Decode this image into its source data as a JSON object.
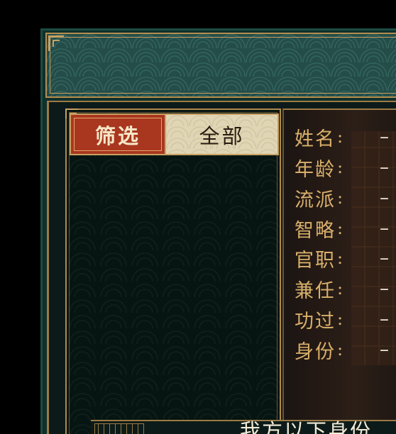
{
  "filter": {
    "label": "筛选",
    "value": "全部"
  },
  "info": {
    "rows": [
      {
        "label": "姓名",
        "colon": ":",
        "value": "–"
      },
      {
        "label": "年龄",
        "colon": ":",
        "value": "–"
      },
      {
        "label": "流派",
        "colon": ":",
        "value": "–"
      },
      {
        "label": "智略",
        "colon": ":",
        "value": "–"
      },
      {
        "label": "官职",
        "colon": ":",
        "value": "–"
      },
      {
        "label": "兼任",
        "colon": ":",
        "value": "–"
      },
      {
        "label": "功过",
        "colon": ":",
        "value": "–"
      },
      {
        "label": "身份",
        "colon": ":",
        "value": "–"
      }
    ]
  },
  "bottom": {
    "text": "我方以下身份"
  },
  "colors": {
    "accent_gold": "#c9a063",
    "filter_red": "#a9361f",
    "panel_teal": "#244d49",
    "label_gold": "#d9b06b"
  },
  "icons": {
    "header_corner": "fret-corner-icon",
    "bottom_ornament": "fret-border-icon"
  }
}
